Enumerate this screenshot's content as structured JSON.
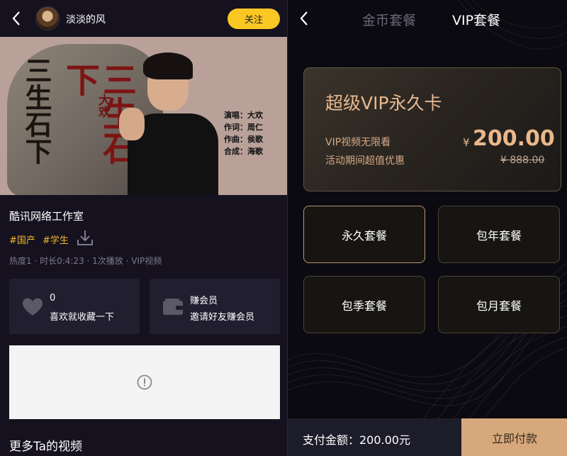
{
  "left": {
    "header": {
      "username": "淡淡的风",
      "follow_label": "关注"
    },
    "cover": {
      "calligraphy": "三生石下",
      "red_title": "三生石下",
      "singer_tag": "大欢",
      "credits": [
        "演唱：大欢",
        "作词：周仁",
        "作曲：侯歌",
        "合成：海歌"
      ]
    },
    "studio": "酷讯网络工作室",
    "tags": [
      "#国产",
      "#学生"
    ],
    "meta": "热度1 · 时长0:4:23 · 1次播放 · VIP视频",
    "like_card": {
      "count": "0",
      "text": "喜欢就收藏一下"
    },
    "earn_card": {
      "title": "赚会员",
      "text": "邀请好友赚会员"
    },
    "more_title": "更多Ta的视频"
  },
  "right": {
    "tabs": [
      "金币套餐",
      "VIP套餐"
    ],
    "active_tab": "VIP套餐",
    "vip_card": {
      "title": "超级VIP永久卡",
      "line1": "VIP视频无限看",
      "line2": "活动期间超值优惠",
      "currency": "¥",
      "price": "200.00",
      "old_price": "¥ 888.00"
    },
    "packages": [
      {
        "label": "永久套餐",
        "selected": true
      },
      {
        "label": "包年套餐",
        "selected": false
      },
      {
        "label": "包季套餐",
        "selected": false
      },
      {
        "label": "包月套餐",
        "selected": false
      }
    ],
    "paybar": {
      "amount": "支付金额：200.00元",
      "button": "立即付款"
    }
  },
  "colors": {
    "follow": "#fbc723",
    "tag": "#f0b62c",
    "gold": "#e7b88f",
    "pay_button": "#d6a87c"
  }
}
